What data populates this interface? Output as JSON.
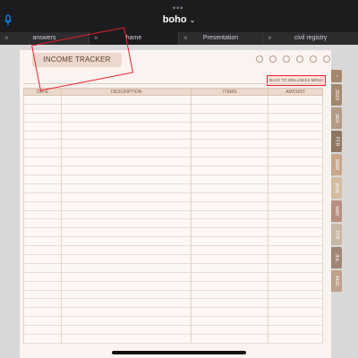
{
  "window": {
    "more_dots": "•••",
    "doc_title": "boho",
    "title_chevron": "⌄"
  },
  "tabs": [
    {
      "label": "answers",
      "close": "×"
    },
    {
      "label": "hame",
      "close": "×"
    },
    {
      "label": "Presentation",
      "close": "×"
    },
    {
      "label": "civil registry",
      "close": "×"
    }
  ],
  "page": {
    "tracker_title": "INCOME TRACKER",
    "back_button": "BACK TO WELLNESS MENU",
    "nav_icons": [
      "person-icon",
      "chat-icon",
      "target-icon",
      "gift-icon",
      "settings-icon",
      "smiley-icon"
    ]
  },
  "ledger": {
    "columns": [
      "DATE",
      "DESCRIPTION",
      "ITEMS",
      "AMOUNT"
    ],
    "row_count": 28
  },
  "sidetabs": [
    {
      "label": "2023",
      "color": "#a4876e"
    },
    {
      "label": "JAN",
      "color": "#b39a86"
    },
    {
      "label": "FEB",
      "color": "#8f7461"
    },
    {
      "label": "MAR",
      "color": "#c9a58a"
    },
    {
      "label": "APR",
      "color": "#d4bda1"
    },
    {
      "label": "MAY",
      "color": "#b88e80"
    },
    {
      "label": "JUN",
      "color": "#c7b7a3"
    },
    {
      "label": "JUL",
      "color": "#a08575"
    },
    {
      "label": "AUG",
      "color": "#bfa089"
    }
  ],
  "colors": {
    "accent_annotation": "#e8202a",
    "page_bg": "#fbf3ef",
    "header_fill": "#ecd8cc"
  }
}
